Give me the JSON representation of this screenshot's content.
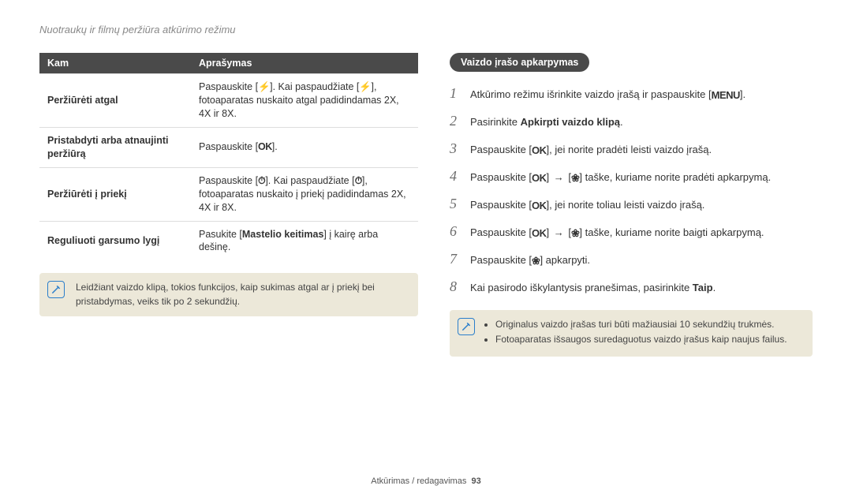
{
  "header": {
    "section_title": "Nuotraukų ir filmų peržiūra atkūrimo režimu"
  },
  "table": {
    "head": {
      "col1": "Kam",
      "col2": "Aprašymas"
    },
    "rows": [
      {
        "k": "Peržiūrėti atgal",
        "v_pre": "Paspauskite [",
        "v_icon1": "flash",
        "v_mid": "]. Kai paspaudžiate [",
        "v_icon2": "flash",
        "v_post": "], fotoaparatas nuskaito atgal padidindamas 2X, 4X ir 8X."
      },
      {
        "k": "Pristabdyti arba atnaujinti peržiūrą",
        "v_pre": "Paspauskite [",
        "v_icon1": "ok",
        "v_post": "]."
      },
      {
        "k": "Peržiūrėti į priekį",
        "v_pre": "Paspauskite [",
        "v_icon1": "timer",
        "v_mid": "]. Kai paspaudžiate [",
        "v_icon2": "timer",
        "v_post": "], fotoaparatas nuskaito į priekį padidindamas 2X, 4X ir 8X."
      },
      {
        "k": "Reguliuoti garsumo lygį",
        "v_pre": "Pasukite [",
        "v_bold": "Mastelio keitimas",
        "v_post": "] į kairę arba dešinę."
      }
    ]
  },
  "note_left": {
    "text": "Leidžiant vaizdo klipą, tokios funkcijos, kaip sukimas atgal ar į priekį bei pristabdymas, veiks tik po 2 sekundžių."
  },
  "right": {
    "heading": "Vaizdo įrašo apkarpymas",
    "steps": [
      {
        "n": "1",
        "pre": "Atkūrimo režimu išrinkite vaizdo įrašą ir paspauskite [",
        "icon": "menu",
        "post": "]."
      },
      {
        "n": "2",
        "pre": "Pasirinkite ",
        "bold": "Apkirpti vaizdo klipą",
        "post": "."
      },
      {
        "n": "3",
        "pre": "Paspauskite [",
        "icon": "ok",
        "post": "], jei norite pradėti leisti vaizdo įrašą."
      },
      {
        "n": "4",
        "pre": "Paspauskite [",
        "icon": "ok",
        "arrow": " → [",
        "icon2": "macro",
        "post": "] taške, kuriame norite pradėti apkarpymą."
      },
      {
        "n": "5",
        "pre": "Paspauskite [",
        "icon": "ok",
        "post": "], jei norite toliau leisti vaizdo įrašą."
      },
      {
        "n": "6",
        "pre": "Paspauskite [",
        "icon": "ok",
        "arrow": " → [",
        "icon2": "macro",
        "post": "] taške, kuriame norite baigti apkarpymą."
      },
      {
        "n": "7",
        "pre": "Paspauskite [",
        "icon": "macro",
        "post": "] apkarpyti."
      },
      {
        "n": "8",
        "pre": "Kai pasirodo iškylantysis pranešimas, pasirinkite ",
        "bold": "Taip",
        "post": "."
      }
    ]
  },
  "note_right": {
    "items": [
      "Originalus vaizdo įrašas turi būti mažiausiai 10 sekundžių trukmės.",
      "Fotoaparatas išsaugos suredaguotus vaizdo įrašus kaip naujus failus."
    ]
  },
  "footer": {
    "text": "Atkūrimas / redagavimas",
    "page": "93"
  },
  "icons": {
    "flash": "⚡",
    "timer": "⏱",
    "ok": "OK",
    "menu": "MENU",
    "macro": "❀"
  }
}
